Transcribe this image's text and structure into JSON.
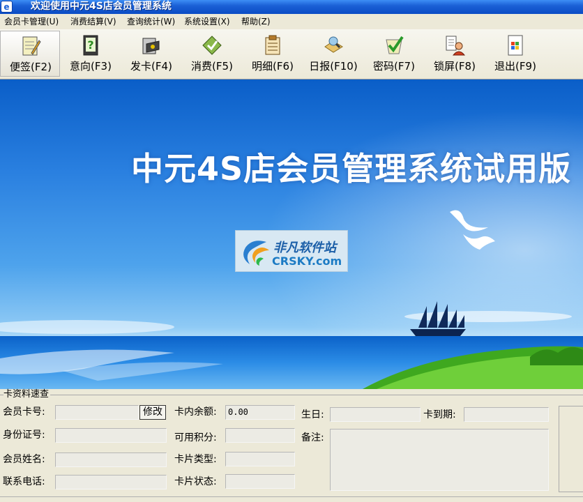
{
  "window": {
    "title": "欢迎使用中元4S店会员管理系统",
    "icon": "app-icon",
    "icon_glyph": "e"
  },
  "menu": {
    "items": [
      {
        "label": "会员卡管理(U)"
      },
      {
        "label": "消费结算(V)"
      },
      {
        "label": "查询统计(W)"
      },
      {
        "label": "系统设置(X)"
      },
      {
        "label": "帮助(Z)"
      }
    ]
  },
  "toolbar": {
    "items": [
      {
        "label": "便签(F2)",
        "icon": "notepad-icon"
      },
      {
        "label": "意向(F3)",
        "icon": "help-book-icon"
      },
      {
        "label": "发卡(F4)",
        "icon": "card-issue-icon"
      },
      {
        "label": "消费(F5)",
        "icon": "consume-icon"
      },
      {
        "label": "明细(F6)",
        "icon": "ledger-icon"
      },
      {
        "label": "日报(F10)",
        "icon": "daily-report-icon"
      },
      {
        "label": "密码(F7)",
        "icon": "password-icon"
      },
      {
        "label": "锁屏(F8)",
        "icon": "lock-screen-icon"
      },
      {
        "label": "退出(F9)",
        "icon": "exit-icon"
      }
    ]
  },
  "banner": {
    "headline": "中元4S店会员管理系统试用版",
    "logo_cn": "非凡软件站",
    "logo_en": "CRSKY.com"
  },
  "card_panel": {
    "legend": "卡资料速查",
    "labels": {
      "card_no": "会员卡号:",
      "id_no": "身份证号:",
      "member_name": "会员姓名:",
      "phone": "联系电话:",
      "balance": "卡内余额:",
      "points": "可用积分:",
      "card_type": "卡片类型:",
      "card_status": "卡片状态:",
      "birthday": "生日:",
      "expiry": "卡到期:",
      "remark": "备注:"
    },
    "values": {
      "card_no": "",
      "id_no": "",
      "member_name": "",
      "phone": "",
      "balance": "0.00",
      "points": "",
      "card_type": "",
      "card_status": "",
      "birthday": "",
      "expiry": "",
      "remark": ""
    },
    "modify_button": "修改"
  },
  "colors": {
    "title_bar": "#1b61d6",
    "sky_top": "#0a5ec8",
    "sea": "#0b62c9",
    "land": "#3fa81f"
  }
}
